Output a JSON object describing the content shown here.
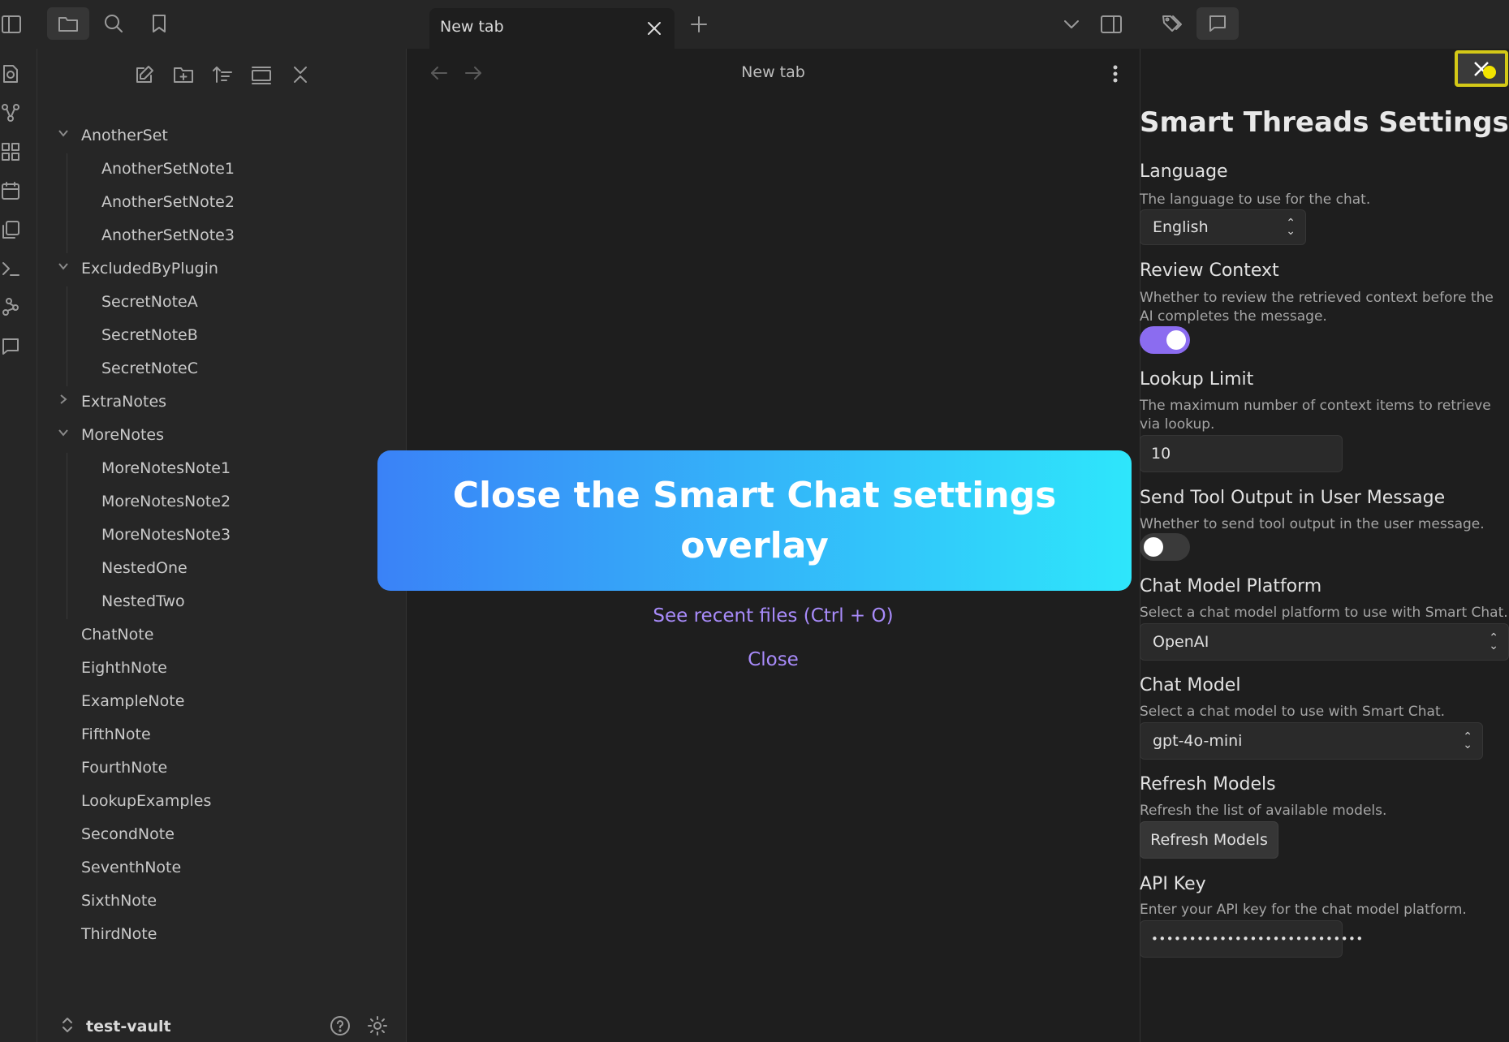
{
  "tab": {
    "title": "New tab"
  },
  "sidebar": {
    "tree": [
      {
        "label": "AnotherSet",
        "type": "folder",
        "expanded": true
      },
      {
        "label": "AnotherSetNote1",
        "type": "file"
      },
      {
        "label": "AnotherSetNote2",
        "type": "file"
      },
      {
        "label": "AnotherSetNote3",
        "type": "file"
      },
      {
        "label": "ExcludedByPlugin",
        "type": "folder",
        "expanded": true
      },
      {
        "label": "SecretNoteA",
        "type": "file"
      },
      {
        "label": "SecretNoteB",
        "type": "file"
      },
      {
        "label": "SecretNoteC",
        "type": "file"
      },
      {
        "label": "ExtraNotes",
        "type": "folder",
        "expanded": false
      },
      {
        "label": "MoreNotes",
        "type": "folder",
        "expanded": true
      },
      {
        "label": "MoreNotesNote1",
        "type": "file"
      },
      {
        "label": "MoreNotesNote2",
        "type": "file"
      },
      {
        "label": "MoreNotesNote3",
        "type": "file"
      },
      {
        "label": "NestedOne",
        "type": "file"
      },
      {
        "label": "NestedTwo",
        "type": "file"
      },
      {
        "label": "ChatNote",
        "type": "file"
      },
      {
        "label": "EighthNote",
        "type": "file"
      },
      {
        "label": "ExampleNote",
        "type": "file"
      },
      {
        "label": "FifthNote",
        "type": "file"
      },
      {
        "label": "FourthNote",
        "type": "file"
      },
      {
        "label": "LookupExamples",
        "type": "file"
      },
      {
        "label": "SecondNote",
        "type": "file"
      },
      {
        "label": "SeventhNote",
        "type": "file"
      },
      {
        "label": "SixthNote",
        "type": "file"
      },
      {
        "label": "ThirdNote",
        "type": "file"
      }
    ],
    "vault_name": "test-vault"
  },
  "editor": {
    "title": "New tab",
    "recent_files_link": "See recent files (Ctrl + O)",
    "close_link": "Close"
  },
  "overlay": {
    "text": "Close the Smart Chat settings overlay"
  },
  "settings": {
    "title": "Smart Threads Settings",
    "language": {
      "name": "Language",
      "desc": "The language to use for the chat.",
      "value": "English"
    },
    "review_context": {
      "name": "Review Context",
      "desc": "Whether to review the retrieved context before the AI completes the message.",
      "enabled": true
    },
    "lookup_limit": {
      "name": "Lookup Limit",
      "desc": "The maximum number of context items to retrieve via lookup.",
      "value": "10"
    },
    "send_tool_output": {
      "name": "Send Tool Output in User Message",
      "desc": "Whether to send tool output in the user message.",
      "enabled": false
    },
    "chat_model_platform": {
      "name": "Chat Model Platform",
      "desc": "Select a chat model platform to use with Smart Chat.",
      "value": "OpenAI"
    },
    "chat_model": {
      "name": "Chat Model",
      "desc": "Select a chat model to use with Smart Chat.",
      "value": "gpt-4o-mini"
    },
    "refresh_models": {
      "name": "Refresh Models",
      "desc": "Refresh the list of available models.",
      "button_label": "Refresh Models"
    },
    "api_key": {
      "name": "API Key",
      "desc": "Enter your API key for the chat model platform.",
      "value": "••••••••••••••••••••••••••••"
    }
  },
  "colors": {
    "accent": "#8b6cf0",
    "link": "#a88bfa",
    "overlay_start": "#3a82f7",
    "overlay_end": "#2ee6fb",
    "highlight": "#d4c917"
  }
}
